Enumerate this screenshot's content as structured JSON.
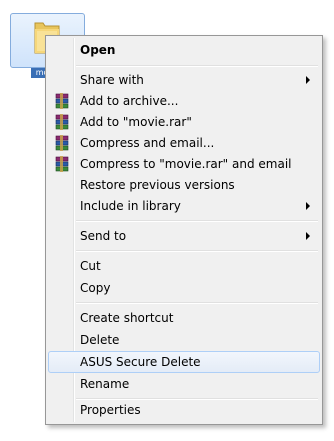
{
  "file": {
    "label": "movie"
  },
  "menu": {
    "items": {
      "open": "Open",
      "share_with": "Share with",
      "add_to_archive": "Add to archive...",
      "add_to_rar": "Add to \"movie.rar\"",
      "compress_email": "Compress and email...",
      "compress_to_rar_email": "Compress to \"movie.rar\" and email",
      "restore_previous": "Restore previous versions",
      "include_library": "Include in library",
      "send_to": "Send to",
      "cut": "Cut",
      "copy": "Copy",
      "create_shortcut": "Create shortcut",
      "delete": "Delete",
      "asus_secure_delete": "ASUS Secure Delete",
      "rename": "Rename",
      "properties": "Properties"
    },
    "highlighted_item": "ASUS Secure Delete",
    "icons": {
      "rar": "winrar-books-icon",
      "submenu": "chevron-right-icon"
    }
  }
}
